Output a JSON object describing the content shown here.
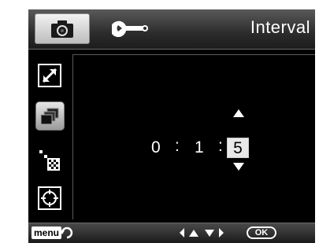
{
  "header": {
    "title": "Interval",
    "tabs": [
      {
        "name": "camera",
        "icon": "camera-icon",
        "selected": true
      },
      {
        "name": "settings",
        "icon": "wrench-icon",
        "selected": false
      }
    ]
  },
  "sidebar": {
    "items": [
      {
        "icon": "resize-icon",
        "selected": false
      },
      {
        "icon": "multi-shot-icon",
        "selected": true
      },
      {
        "icon": "quality-icon",
        "selected": false
      },
      {
        "icon": "focus-icon",
        "selected": false
      }
    ]
  },
  "interval": {
    "hours": "0",
    "minutes": "1",
    "seconds": "5",
    "separator": ":"
  },
  "footer": {
    "menu_label": "menu",
    "ok_label": "OK"
  },
  "colors": {
    "background": "#000000",
    "highlight": "#e8e8e8",
    "text": "#ffffff"
  }
}
